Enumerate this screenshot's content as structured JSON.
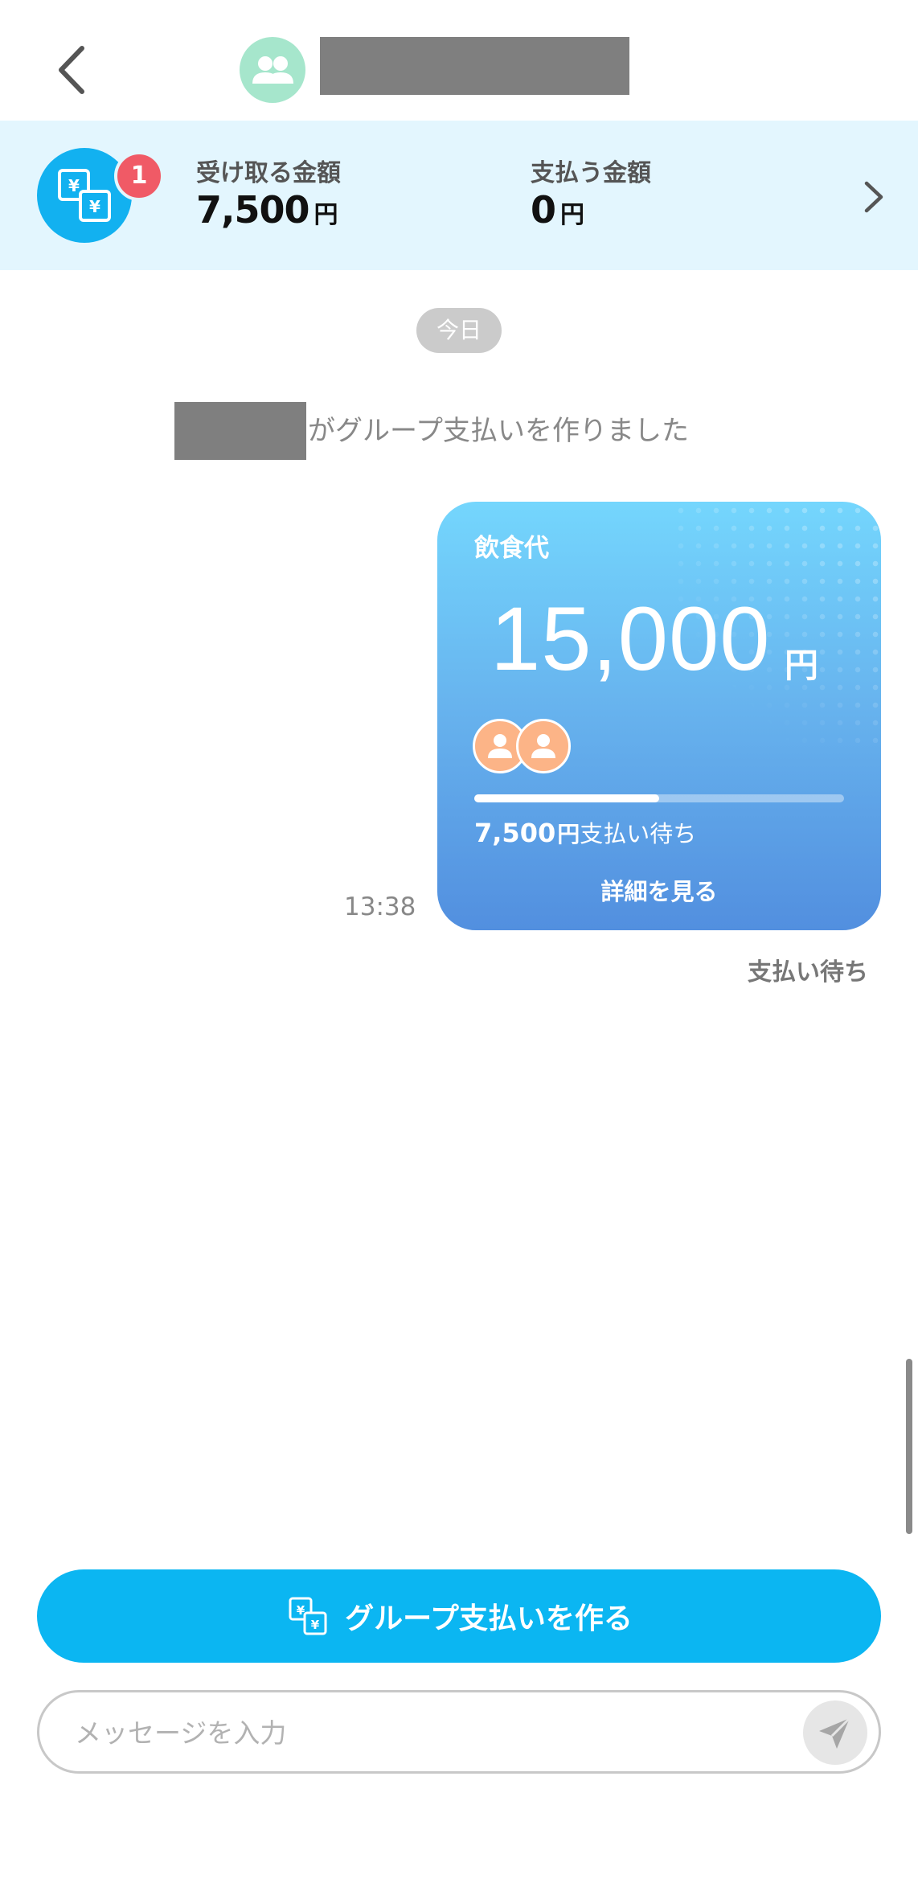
{
  "header": {
    "back_icon": "chevron-left-icon",
    "avatar_icon": "group-people-icon",
    "group_name": ""
  },
  "summary": {
    "icon": "yen-exchange-icon",
    "badge_count": "1",
    "receive_label": "受け取る金額",
    "receive_amount": "7,500",
    "receive_unit": "円",
    "pay_label": "支払う金額",
    "pay_amount": "0",
    "pay_unit": "円",
    "chevron_icon": "chevron-right-icon"
  },
  "chat": {
    "day_label": "今日",
    "system_message": "がグループ支払いを作りました",
    "payment_card": {
      "title": "飲食代",
      "amount": "15,000",
      "unit": "円",
      "members": [
        "person-icon",
        "person-icon"
      ],
      "progress": 0.5,
      "pending_amount": "7,500",
      "pending_unit": "円",
      "pending_label": "支払い待ち",
      "detail_label": "詳細を見る"
    },
    "time": "13:38",
    "status": "支払い待ち"
  },
  "footer": {
    "create_button": "グループ支払いを作る",
    "create_icon": "yen-exchange-icon",
    "message_placeholder": "メッセージを入力",
    "send_icon": "send-icon"
  },
  "colors": {
    "accent": "#0bb6f2",
    "banner_bg": "#e3f6fe",
    "badge": "#f05a66",
    "avatar": "#a6e6cc"
  }
}
